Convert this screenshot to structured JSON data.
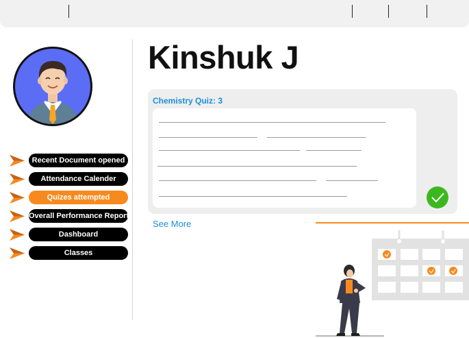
{
  "profile": {
    "name": "Kinshuk J"
  },
  "nav": {
    "items": [
      {
        "label": "Recent Document opened",
        "active": false
      },
      {
        "label": "Attendance Calender",
        "active": false
      },
      {
        "label": "Quizes attempted",
        "active": true
      },
      {
        "label": "Overall Performance Report",
        "active": false
      },
      {
        "label": "Dashboard",
        "active": false
      },
      {
        "label": "Classes",
        "active": false
      }
    ]
  },
  "quiz": {
    "title": "Chemistry Quiz: 3",
    "status_icon": "check-icon",
    "see_more_label": "See More"
  },
  "colors": {
    "accent_orange": "#f68a1e",
    "link_blue": "#1a8fd8",
    "success_green": "#3cb81e",
    "avatar_bg": "#5b6cf5"
  }
}
